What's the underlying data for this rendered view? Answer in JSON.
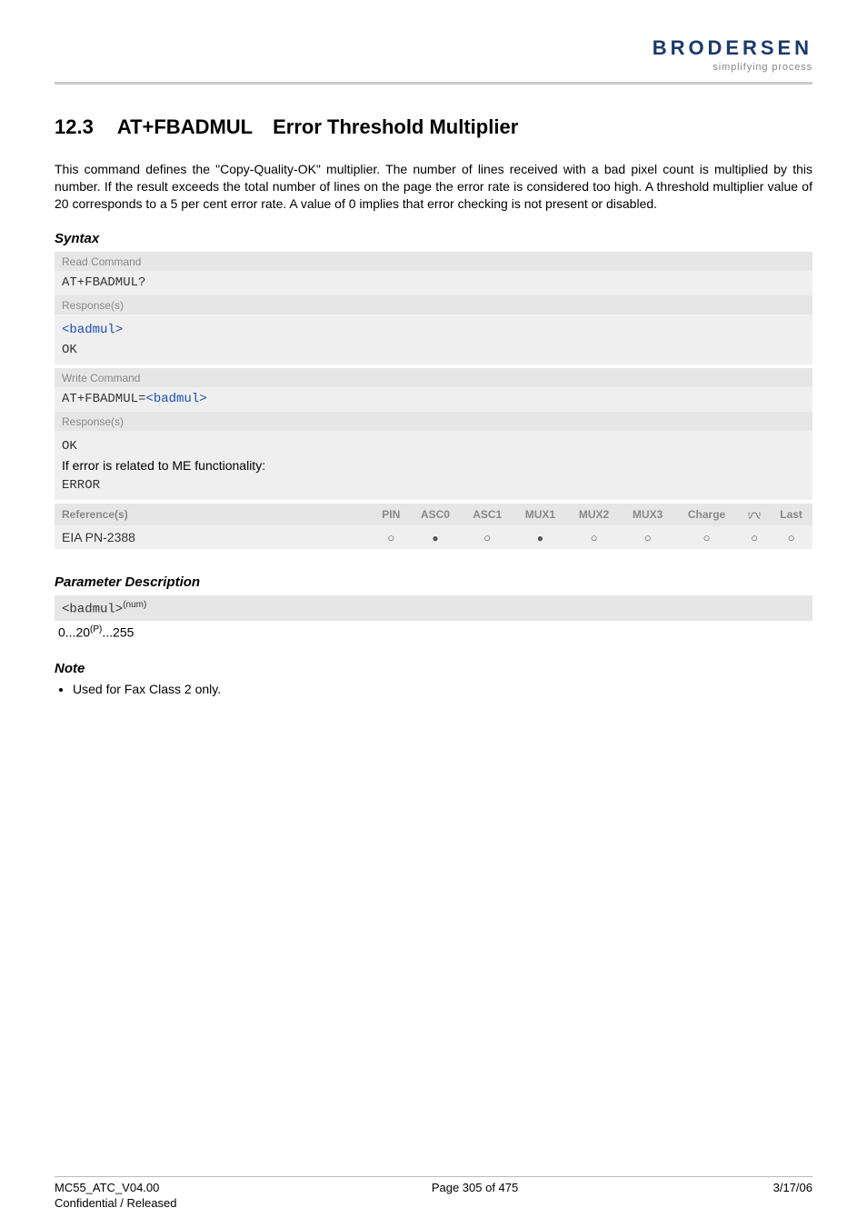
{
  "logo": {
    "brand": "BRODERSEN",
    "tagline": "simplifying process"
  },
  "section": {
    "number": "12.3",
    "cmd": "AT+FBADMUL",
    "name": "Error Threshold Multiplier"
  },
  "body": {
    "para": "This command defines the \"Copy-Quality-OK\" multiplier. The number of lines received with a bad pixel count is multiplied by this number. If the result exceeds the total number of lines on the page the error rate is considered too high. A threshold multiplier value of 20 corresponds to a 5 per cent error rate. A value of 0 implies that error checking is not present or disabled."
  },
  "subheads": {
    "syntax": "Syntax",
    "param_desc": "Parameter Description",
    "note": "Note"
  },
  "syntax": {
    "read_label": "Read Command",
    "read_cmd": "AT+FBADMUL?",
    "read_resp_label": "Response(s)",
    "read_resp_param": "<badmul>",
    "read_resp_ok": "OK",
    "write_label": "Write Command",
    "write_cmd_prefix": "AT+FBADMUL=",
    "write_cmd_param": "<badmul>",
    "write_resp_label": "Response(s)",
    "write_resp_ok": "OK",
    "write_resp_text": "If error is related to ME functionality:",
    "write_resp_error": "ERROR"
  },
  "ref": {
    "head_label": "Reference(s)",
    "cols": [
      "PIN",
      "ASC0",
      "ASC1",
      "MUX1",
      "MUX2",
      "MUX3",
      "Charge",
      "➛",
      "Last"
    ],
    "body_label": "EIA PN-2388",
    "body_vals": [
      "open",
      "filled",
      "open",
      "filled",
      "open",
      "open",
      "open",
      "open",
      "open"
    ]
  },
  "param": {
    "name": "<badmul>",
    "sup": "(num)",
    "range_pre": "0...20",
    "range_sup": "(P)",
    "range_post": "...255"
  },
  "note": {
    "item1": "Used for Fax Class 2 only."
  },
  "footer": {
    "left1": "MC55_ATC_V04.00",
    "left2": "Confidential / Released",
    "center": "Page 305 of 475",
    "right": "3/17/06"
  },
  "ring_icon_title": "ring-icon"
}
